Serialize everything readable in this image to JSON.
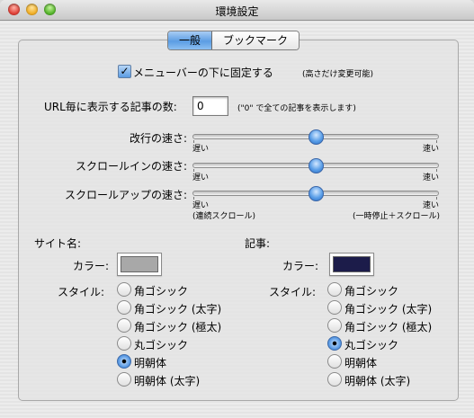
{
  "window": {
    "title": "環境設定"
  },
  "colors": {
    "site_color": "#a8a8a8",
    "article_color": "#1c1c4a",
    "accent": "#5b9de3"
  },
  "tabs": [
    {
      "label": "一般",
      "active": true
    },
    {
      "label": "ブックマーク",
      "active": false
    }
  ],
  "menubar_option": {
    "label": "メニューバーの下に固定する",
    "note": "(高さだけ変更可能)",
    "checked": true,
    "checkmark": "✓"
  },
  "articles_per_url": {
    "label": "URL毎に表示する記事の数:",
    "value": "0",
    "note": "(\"0\" で全ての記事を表示します)"
  },
  "sliders": [
    {
      "label": "改行の速さ:",
      "min_label": "遅い",
      "max_label": "速い",
      "value": 0.5
    },
    {
      "label": "スクロールインの速さ:",
      "min_label": "遅い",
      "max_label": "速い",
      "value": 0.5
    },
    {
      "label": "スクロールアップの速さ:",
      "min_label": "遅い",
      "max_label": "速い",
      "value": 0.5,
      "min_sub": "(連続スクロール)",
      "max_sub": "(一時停止＋スクロール)"
    }
  ],
  "site": {
    "heading": "サイト名:",
    "color_label": "カラー:",
    "style_label": "スタイル:",
    "options": [
      "角ゴシック",
      "角ゴシック (太字)",
      "角ゴシック (極太)",
      "丸ゴシック",
      "明朝体",
      "明朝体 (太字)"
    ],
    "selected": 4
  },
  "article": {
    "heading": "記事:",
    "color_label": "カラー:",
    "style_label": "スタイル:",
    "options": [
      "角ゴシック",
      "角ゴシック (太字)",
      "角ゴシック (極太)",
      "丸ゴシック",
      "明朝体",
      "明朝体 (太字)"
    ],
    "selected": 3
  }
}
